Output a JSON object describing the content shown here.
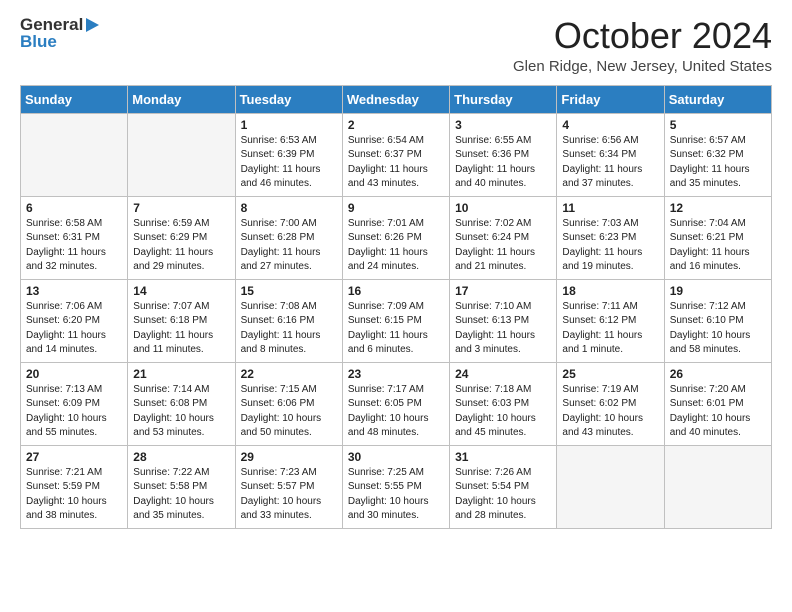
{
  "header": {
    "logo_general": "General",
    "logo_blue": "Blue",
    "month_title": "October 2024",
    "location": "Glen Ridge, New Jersey, United States"
  },
  "days_of_week": [
    "Sunday",
    "Monday",
    "Tuesday",
    "Wednesday",
    "Thursday",
    "Friday",
    "Saturday"
  ],
  "weeks": [
    [
      {
        "day": "",
        "info": ""
      },
      {
        "day": "",
        "info": ""
      },
      {
        "day": "1",
        "info": "Sunrise: 6:53 AM\nSunset: 6:39 PM\nDaylight: 11 hours and 46 minutes."
      },
      {
        "day": "2",
        "info": "Sunrise: 6:54 AM\nSunset: 6:37 PM\nDaylight: 11 hours and 43 minutes."
      },
      {
        "day": "3",
        "info": "Sunrise: 6:55 AM\nSunset: 6:36 PM\nDaylight: 11 hours and 40 minutes."
      },
      {
        "day": "4",
        "info": "Sunrise: 6:56 AM\nSunset: 6:34 PM\nDaylight: 11 hours and 37 minutes."
      },
      {
        "day": "5",
        "info": "Sunrise: 6:57 AM\nSunset: 6:32 PM\nDaylight: 11 hours and 35 minutes."
      }
    ],
    [
      {
        "day": "6",
        "info": "Sunrise: 6:58 AM\nSunset: 6:31 PM\nDaylight: 11 hours and 32 minutes."
      },
      {
        "day": "7",
        "info": "Sunrise: 6:59 AM\nSunset: 6:29 PM\nDaylight: 11 hours and 29 minutes."
      },
      {
        "day": "8",
        "info": "Sunrise: 7:00 AM\nSunset: 6:28 PM\nDaylight: 11 hours and 27 minutes."
      },
      {
        "day": "9",
        "info": "Sunrise: 7:01 AM\nSunset: 6:26 PM\nDaylight: 11 hours and 24 minutes."
      },
      {
        "day": "10",
        "info": "Sunrise: 7:02 AM\nSunset: 6:24 PM\nDaylight: 11 hours and 21 minutes."
      },
      {
        "day": "11",
        "info": "Sunrise: 7:03 AM\nSunset: 6:23 PM\nDaylight: 11 hours and 19 minutes."
      },
      {
        "day": "12",
        "info": "Sunrise: 7:04 AM\nSunset: 6:21 PM\nDaylight: 11 hours and 16 minutes."
      }
    ],
    [
      {
        "day": "13",
        "info": "Sunrise: 7:06 AM\nSunset: 6:20 PM\nDaylight: 11 hours and 14 minutes."
      },
      {
        "day": "14",
        "info": "Sunrise: 7:07 AM\nSunset: 6:18 PM\nDaylight: 11 hours and 11 minutes."
      },
      {
        "day": "15",
        "info": "Sunrise: 7:08 AM\nSunset: 6:16 PM\nDaylight: 11 hours and 8 minutes."
      },
      {
        "day": "16",
        "info": "Sunrise: 7:09 AM\nSunset: 6:15 PM\nDaylight: 11 hours and 6 minutes."
      },
      {
        "day": "17",
        "info": "Sunrise: 7:10 AM\nSunset: 6:13 PM\nDaylight: 11 hours and 3 minutes."
      },
      {
        "day": "18",
        "info": "Sunrise: 7:11 AM\nSunset: 6:12 PM\nDaylight: 11 hours and 1 minute."
      },
      {
        "day": "19",
        "info": "Sunrise: 7:12 AM\nSunset: 6:10 PM\nDaylight: 10 hours and 58 minutes."
      }
    ],
    [
      {
        "day": "20",
        "info": "Sunrise: 7:13 AM\nSunset: 6:09 PM\nDaylight: 10 hours and 55 minutes."
      },
      {
        "day": "21",
        "info": "Sunrise: 7:14 AM\nSunset: 6:08 PM\nDaylight: 10 hours and 53 minutes."
      },
      {
        "day": "22",
        "info": "Sunrise: 7:15 AM\nSunset: 6:06 PM\nDaylight: 10 hours and 50 minutes."
      },
      {
        "day": "23",
        "info": "Sunrise: 7:17 AM\nSunset: 6:05 PM\nDaylight: 10 hours and 48 minutes."
      },
      {
        "day": "24",
        "info": "Sunrise: 7:18 AM\nSunset: 6:03 PM\nDaylight: 10 hours and 45 minutes."
      },
      {
        "day": "25",
        "info": "Sunrise: 7:19 AM\nSunset: 6:02 PM\nDaylight: 10 hours and 43 minutes."
      },
      {
        "day": "26",
        "info": "Sunrise: 7:20 AM\nSunset: 6:01 PM\nDaylight: 10 hours and 40 minutes."
      }
    ],
    [
      {
        "day": "27",
        "info": "Sunrise: 7:21 AM\nSunset: 5:59 PM\nDaylight: 10 hours and 38 minutes."
      },
      {
        "day": "28",
        "info": "Sunrise: 7:22 AM\nSunset: 5:58 PM\nDaylight: 10 hours and 35 minutes."
      },
      {
        "day": "29",
        "info": "Sunrise: 7:23 AM\nSunset: 5:57 PM\nDaylight: 10 hours and 33 minutes."
      },
      {
        "day": "30",
        "info": "Sunrise: 7:25 AM\nSunset: 5:55 PM\nDaylight: 10 hours and 30 minutes."
      },
      {
        "day": "31",
        "info": "Sunrise: 7:26 AM\nSunset: 5:54 PM\nDaylight: 10 hours and 28 minutes."
      },
      {
        "day": "",
        "info": ""
      },
      {
        "day": "",
        "info": ""
      }
    ]
  ]
}
